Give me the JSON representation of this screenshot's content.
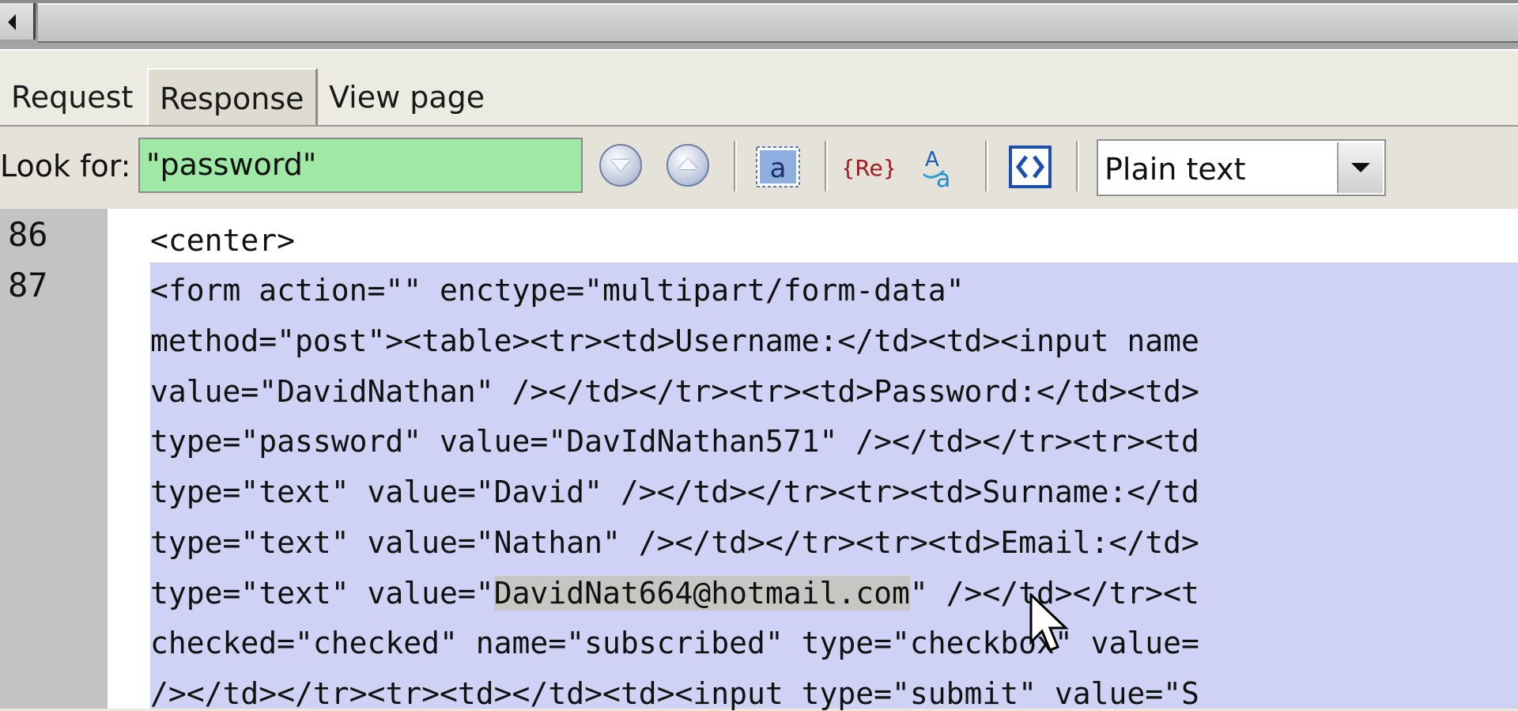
{
  "tabs": [
    {
      "label": "Request"
    },
    {
      "label": "Response"
    },
    {
      "label": "View page"
    }
  ],
  "active_tab": "Response",
  "toolbar": {
    "look_for_label": "Look for:",
    "search_value": "\"password\"",
    "search_color": "#9fe8a5",
    "format_select": "Plain text"
  },
  "code": {
    "line_numbers": [
      "86",
      "87"
    ],
    "lines": [
      "<center>",
      "<form action=\"\" enctype=\"multipart/form-data\"",
      "method=\"post\"><table><tr><td>Username:</td><td><input name",
      "value=\"DavidNathan\" /></td></tr><tr><td>Password:</td><td>",
      "type=\"password\" value=\"DavIdNathan571\" /></td></tr><tr><td",
      "type=\"text\" value=\"David\" /></td></tr><tr><td>Surname:</td",
      "type=\"text\" value=\"Nathan\" /></td></tr><tr><td>Email:</td>",
      "type=\"text\" value=\"",
      "DavidNat664@hotmail.com",
      "\" /></td></tr><t",
      "checked=\"checked\" name=\"subscribed\" type=\"checkbox\" value=",
      "/></td></tr><tr><td></td><td><input type=\"submit\" value=\"S"
    ],
    "selection_color": "#cfd2f4"
  }
}
